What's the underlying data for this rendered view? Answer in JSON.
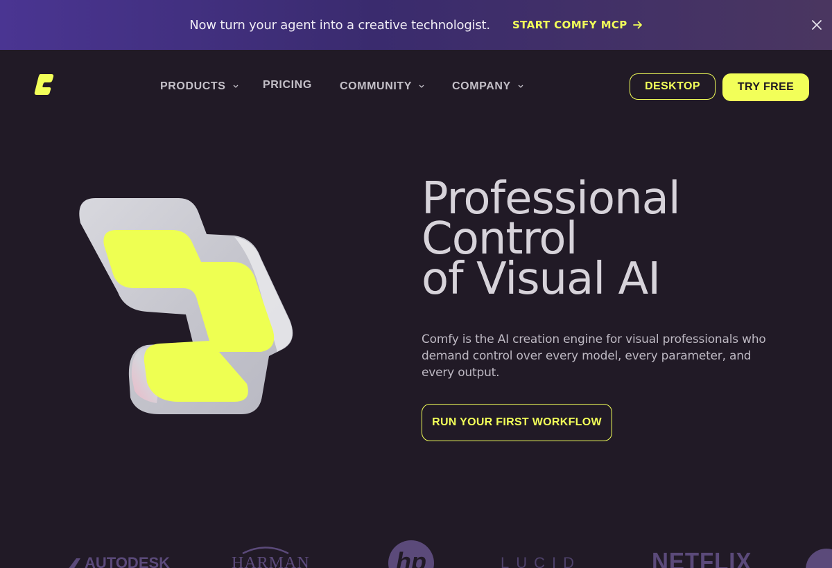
{
  "banner": {
    "text": "Now turn your agent into a creative technologist.",
    "cta_label": "START COMFY MCP",
    "cta_icon": "arrow-right-icon",
    "close_icon": "close-icon"
  },
  "nav": {
    "logo_icon": "comfy-logo-icon",
    "items": [
      {
        "label": "PRODUCTS",
        "has_dropdown": true
      },
      {
        "label": "PRICING",
        "has_dropdown": false
      },
      {
        "label": "COMMUNITY",
        "has_dropdown": true
      },
      {
        "label": "COMPANY",
        "has_dropdown": true
      }
    ],
    "desktop_label": "DESKTOP",
    "try_free_label": "TRY FREE"
  },
  "hero": {
    "title_lines": [
      "Professional",
      "Control",
      "of Visual AI"
    ],
    "subtitle": "Comfy is the AI creation engine for visual professionals who demand control over every model, every parameter, and every output.",
    "cta_label": "RUN YOUR FIRST WORKFLOW"
  },
  "logos": {
    "autodesk": "AUTODESK",
    "harman": "HARMAN",
    "hp": "hp",
    "lucid": "LUCID",
    "netflix": "NETFLIX"
  },
  "colors": {
    "background": "#211a26",
    "accent": "#f2ff59",
    "banner_start": "#4a3592",
    "banner_end": "#4a3660",
    "brand_logo": "#5b4a7a"
  }
}
